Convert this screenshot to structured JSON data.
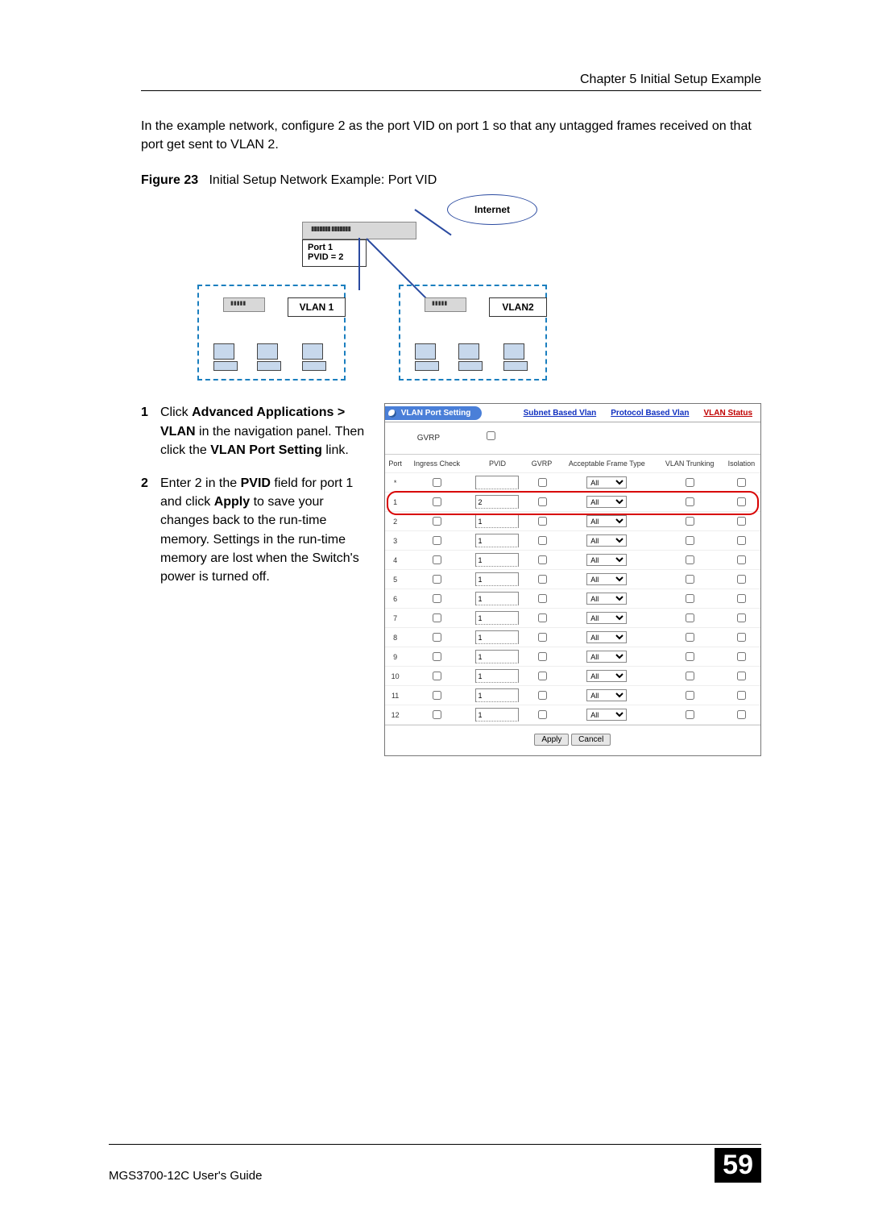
{
  "header": {
    "chapter": "Chapter 5 Initial Setup Example"
  },
  "intro": "In the example network, configure 2 as the port VID on port 1 so that any untagged frames received on that port get sent to VLAN 2.",
  "figure": {
    "label": "Figure 23",
    "caption": "Initial Setup Network Example: Port VID",
    "internet": "Internet",
    "port_label_l1": "Port 1",
    "port_label_l2": "PVID = 2",
    "vlan1": "VLAN 1",
    "vlan2": "VLAN2"
  },
  "steps": [
    {
      "n": "1",
      "pre": "Click ",
      "b1": "Advanced Applications > VLAN",
      "mid1": " in the navigation panel. Then click the ",
      "b2": "VLAN Port Setting",
      "post": " link."
    },
    {
      "n": "2",
      "pre": "Enter 2 in the ",
      "b1": "PVID",
      "mid1": " field for port 1 and click ",
      "b2": "Apply",
      "post": " to save your changes back to the run-time memory. Settings in the run-time memory are lost when the Switch's power is turned off."
    }
  ],
  "panel": {
    "tab_active": "VLAN Port Setting",
    "links": {
      "subnet": "Subnet Based Vlan",
      "protocol": "Protocol Based Vlan",
      "status": "VLAN Status"
    },
    "gvrp_label": "GVRP",
    "headers": {
      "port": "Port",
      "ingress": "Ingress Check",
      "pvid": "PVID",
      "gvrp": "GVRP",
      "aft": "Acceptable Frame Type",
      "trunk": "VLAN Trunking",
      "iso": "Isolation"
    },
    "star": "*",
    "aft_option": "All",
    "rows": [
      {
        "port": "1",
        "pvid": "2"
      },
      {
        "port": "2",
        "pvid": "1"
      },
      {
        "port": "3",
        "pvid": "1"
      },
      {
        "port": "4",
        "pvid": "1"
      },
      {
        "port": "5",
        "pvid": "1"
      },
      {
        "port": "6",
        "pvid": "1"
      },
      {
        "port": "7",
        "pvid": "1"
      },
      {
        "port": "8",
        "pvid": "1"
      },
      {
        "port": "9",
        "pvid": "1"
      },
      {
        "port": "10",
        "pvid": "1"
      },
      {
        "port": "11",
        "pvid": "1"
      },
      {
        "port": "12",
        "pvid": "1"
      }
    ],
    "buttons": {
      "apply": "Apply",
      "cancel": "Cancel"
    }
  },
  "footer": {
    "guide": "MGS3700-12C User's Guide",
    "page": "59"
  }
}
